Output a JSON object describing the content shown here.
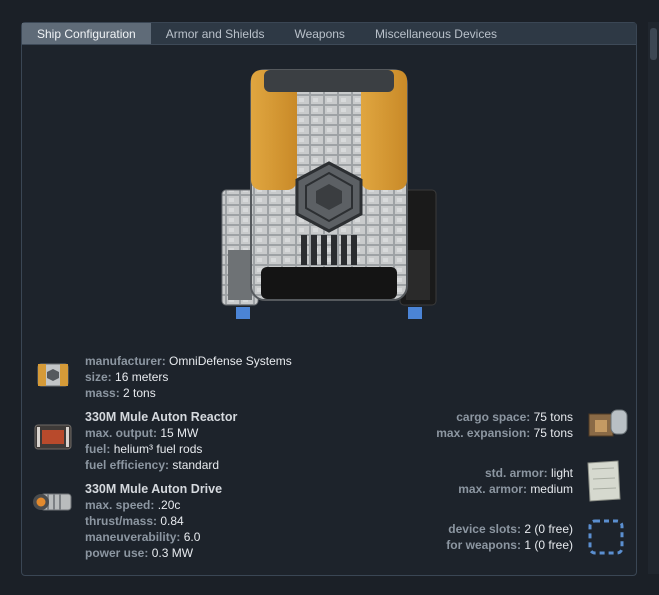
{
  "tabs": [
    {
      "label": "Ship Configuration",
      "active": true
    },
    {
      "label": "Armor and Shields"
    },
    {
      "label": "Weapons"
    },
    {
      "label": "Miscellaneous Devices"
    }
  ],
  "general": {
    "manufacturer_label": "manufacturer:",
    "manufacturer": "OmniDefense Systems",
    "size_label": "size:",
    "size": "16 meters",
    "mass_label": "mass:",
    "mass": "2 tons"
  },
  "reactor": {
    "name": "330M Mule Auton Reactor",
    "output_label": "max. output:",
    "output": "15 MW",
    "fuel_label": "fuel:",
    "fuel": "helium³ fuel rods",
    "efficiency_label": "fuel efficiency:",
    "efficiency": "standard"
  },
  "drive": {
    "name": "330M Mule Auton Drive",
    "speed_label": "max. speed:",
    "speed": ".20c",
    "thrust_label": "thrust/mass:",
    "thrust": "0.84",
    "maneuver_label": "maneuverability:",
    "maneuver": "6.0",
    "power_label": "power use:",
    "power": "0.3 MW"
  },
  "cargo": {
    "space_label": "cargo space:",
    "space": "75 tons",
    "expansion_label": "max. expansion:",
    "expansion": "75 tons"
  },
  "armor": {
    "std_label": "std. armor:",
    "std": "light",
    "max_label": "max. armor:",
    "max": "medium"
  },
  "devices": {
    "slots_label": "device slots:",
    "slots": "2 (0 free)",
    "weapons_label": "for weapons:",
    "weapons": "1 (0 free)"
  }
}
